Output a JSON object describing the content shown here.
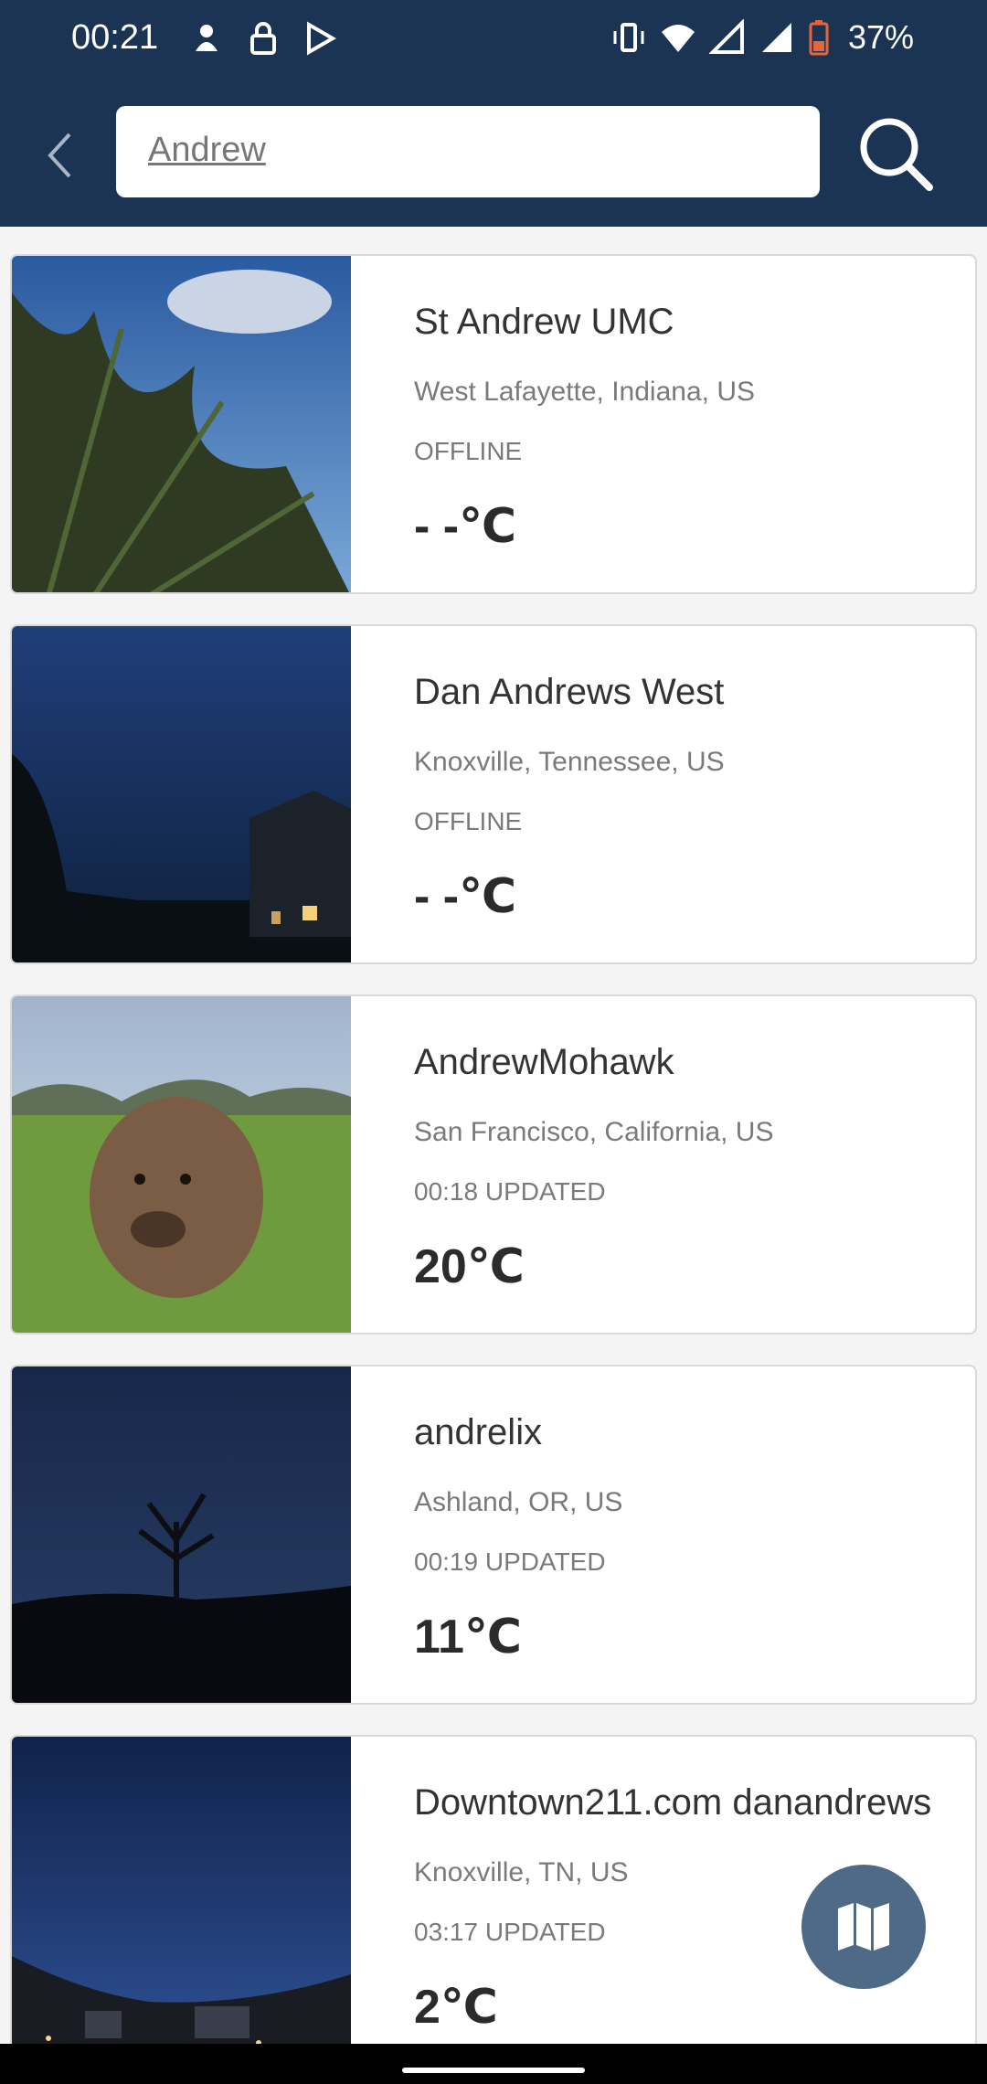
{
  "status_bar": {
    "time": "00:21",
    "battery": "37%",
    "icons_left": [
      "notification-icon",
      "lock-icon",
      "play-store-icon"
    ],
    "icons_right": [
      "vibrate-icon",
      "wifi-icon",
      "signal-icon",
      "signal-icon",
      "battery-icon"
    ]
  },
  "search": {
    "query": "Andrew"
  },
  "results": [
    {
      "name": "St Andrew UMC",
      "location": "West Lafayette,  Indiana,  US",
      "status": "OFFLINE",
      "temp": "- -℃"
    },
    {
      "name": "Dan  Andrews West",
      "location": "Knoxville,  Tennessee,  US",
      "status": "OFFLINE",
      "temp": "- -℃"
    },
    {
      "name": "AndrewMohawk",
      "location": "San Francisco,  California,  US",
      "status": "00:18 UPDATED",
      "temp": "20℃"
    },
    {
      "name": "andrelix",
      "location": "Ashland, OR,  US",
      "status": "00:19 UPDATED",
      "temp": "11℃"
    },
    {
      "name": "Downtown211.com  danandrews",
      "location": "Knoxville, TN,  US",
      "status": "03:17 UPDATED",
      "temp": "2℃"
    }
  ],
  "colors": {
    "header": "#1c3454",
    "fab": "#4f6a86"
  }
}
